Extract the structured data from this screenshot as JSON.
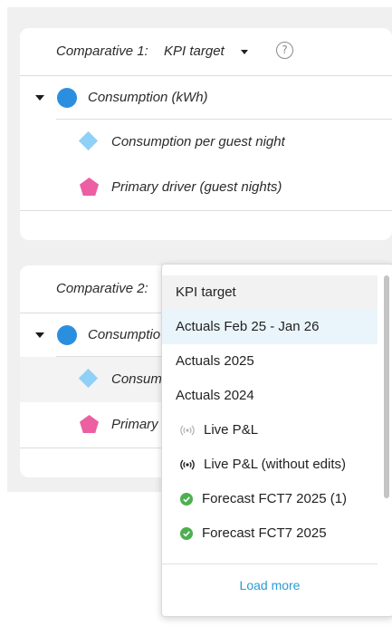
{
  "comparative1": {
    "label": "Comparative 1:",
    "value": "KPI target",
    "rows": [
      {
        "text": "Consumption (kWh)",
        "icon": "blue-circle"
      },
      {
        "text": "Consumption per guest night",
        "icon": "light-blue-diamond"
      },
      {
        "text": "Primary driver (guest nights)",
        "icon": "pink-pentagon"
      }
    ]
  },
  "comparative2": {
    "label": "Comparative 2:",
    "rows": [
      {
        "text": "Consumptio",
        "icon": "blue-circle"
      },
      {
        "text": "Consum",
        "icon": "light-blue-diamond"
      },
      {
        "text": "Primary",
        "icon": "pink-pentagon"
      }
    ]
  },
  "dropdown": {
    "options": [
      {
        "label": "KPI target",
        "state": "selected"
      },
      {
        "label": "Actuals Feb 25 - Jan 26",
        "state": "hover"
      },
      {
        "label": "Actuals 2025"
      },
      {
        "label": "Actuals 2024"
      },
      {
        "label": "Live P&L",
        "icon": "live-broadcast-icon-light"
      },
      {
        "label": "Live P&L (without edits)",
        "icon": "live-broadcast-icon-dark"
      },
      {
        "label": "Forecast FCT7 2025 (1)",
        "icon": "green-check-icon"
      },
      {
        "label": "Forecast FCT7 2025",
        "icon": "green-check-icon"
      }
    ],
    "load_more": "Load more"
  },
  "colors": {
    "circle": "#2b8fe0",
    "diamond": "#8fd0f7",
    "pentagon": "#ec5fa2",
    "check": "#4cb050",
    "link": "#2a9bd0",
    "hover": "#eaf5fb"
  }
}
